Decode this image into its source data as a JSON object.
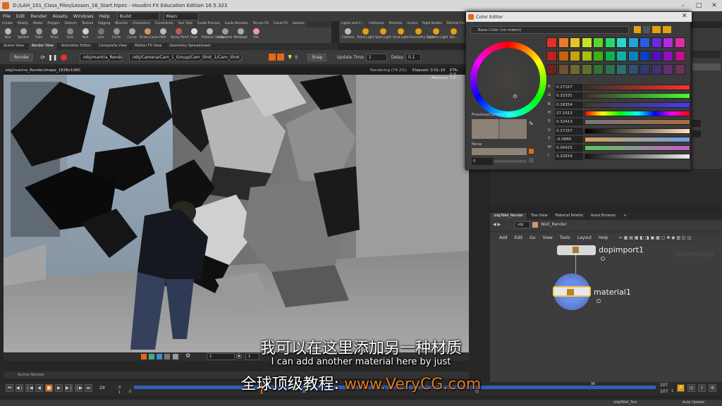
{
  "window": {
    "title": "D:/LAH_101_Class_Files/Lesson_16_Start.hipnc - Houdini FX Education Edition 16.5.323"
  },
  "menu": {
    "items": [
      "File",
      "Edit",
      "Render",
      "Assets",
      "Windows",
      "Help"
    ],
    "desktop": "Build",
    "context": "Main"
  },
  "shelf": {
    "tabs": [
      "Create",
      "Modify",
      "Model",
      "Polygon",
      "Deform",
      "Texture",
      "Rigging",
      "Muscles",
      "Characters",
      "Constraints",
      "Hair Utils",
      "Guide Process",
      "Guide Brushes",
      "Terrain FX",
      "Cloud FX",
      "Volume"
    ],
    "tools": [
      "Box",
      "Sphere",
      "Tube",
      "Torus",
      "Grid",
      "Null",
      "Line",
      "Circle",
      "Curve",
      "Draw Curve",
      "Path",
      "Spray Paint",
      "Font",
      "Platonic Solids",
      "L-System",
      "Metaball",
      "File"
    ],
    "tabs2": [
      "Lights and C...",
      "Collisions",
      "Particles",
      "Grains",
      "Rigid Bodies",
      "Particle Flu..."
    ],
    "tools2": [
      "Camera",
      "Point Light",
      "Spot Light",
      "Area Light",
      "Geometry Light",
      "Volume Light",
      "Dis..."
    ]
  },
  "panetabs": [
    "Scene View",
    "Render View",
    "Animation Editor",
    "Composite View",
    "Motion FX View",
    "Geometry Spreadsheet"
  ],
  "render_toolbar": {
    "render_btn": "Render",
    "rop": "/obj/mantra_Render",
    "camera": "/obj/Camera/Cam_1_Group/Cam_Shot_1/Cam_Shot_Shape1",
    "snap": "Snap",
    "update_label": "Update Time",
    "update_val": "1",
    "delay_label": "Delay",
    "delay_val": "0.1"
  },
  "viewport": {
    "path": "/obj/mantra_Render/shape_1838x1080",
    "status": "Rendering (74.2%)",
    "elapsed": "Elapsed: 0:01:10",
    "eta": "ETA: 0:0...",
    "memory_label": "Memory:",
    "memory_val": "1.0..."
  },
  "render_bottom": {
    "frame": "1",
    "frame2": "1"
  },
  "active_render": "Active Render",
  "timeline": {
    "frame": "29",
    "start": "0",
    "marks": [
      "0",
      "36",
      "72",
      "96"
    ],
    "end1": "107",
    "end2": "107",
    "one": "1",
    "one2": "1"
  },
  "status": {
    "path": "/obj/Wall_Sim",
    "update": "Auto Update"
  },
  "color_editor": {
    "title": "Color Editor",
    "base": "Base Color (no match)",
    "prev_current": "Previous/Current Colors",
    "none": "None",
    "none_val": "0",
    "sliders": [
      {
        "label": "R",
        "value": "0.27157"
      },
      {
        "label": "G",
        "value": "0.22331"
      },
      {
        "label": "B",
        "value": "0.18354"
      },
      {
        "label": "H",
        "value": "27.1013"
      },
      {
        "label": "S",
        "value": "0.32413"
      },
      {
        "label": "V",
        "value": "0.27157"
      },
      {
        "label": "T",
        "value": "-0.0880"
      },
      {
        "label": "M",
        "value": "0.00425"
      },
      {
        "label": "I",
        "value": "0.22614"
      }
    ],
    "palette": [
      "#e0302a",
      "#e87a2a",
      "#e8c22a",
      "#c9e02a",
      "#5fd52a",
      "#2ad56b",
      "#2ad5c9",
      "#2a9fe0",
      "#2a5ee0",
      "#6a2ae0",
      "#b52ae0",
      "#e02aa6",
      "#c02020",
      "#c86010",
      "#c8a210",
      "#a8c010",
      "#40b010",
      "#10b050",
      "#10b0a8",
      "#1080c0",
      "#1040c0",
      "#5010c0",
      "#9010c0",
      "#c01088",
      "#702020",
      "#705030",
      "#706a30",
      "#5e7030",
      "#357030",
      "#307050",
      "#306e6e",
      "#304f70",
      "#303870",
      "#433070",
      "#603070",
      "#703058"
    ]
  },
  "network": {
    "tabs": [
      "/obj/Wall_Render",
      "Tree View",
      "Material Palette",
      "Asset Browser"
    ],
    "path_obj": "obj",
    "path_node": "Wall_Render",
    "menu": [
      "Add",
      "Edit",
      "Go",
      "View",
      "Tools",
      "Layout",
      "Help"
    ],
    "context_label": "Geometry",
    "nodes": [
      {
        "name": "dopimport1"
      },
      {
        "name": "material1"
      }
    ]
  },
  "subtitles": {
    "zh": "我可以在这里添加另一种材质",
    "en": "I can add another material here by just",
    "watermark_zh": "全球顶级教程:",
    "watermark_url": "www.VeryCG.com"
  },
  "colors": {
    "accent": "#e36a12",
    "selected": "#f2c94c",
    "rendering": "#3a6fcf"
  }
}
